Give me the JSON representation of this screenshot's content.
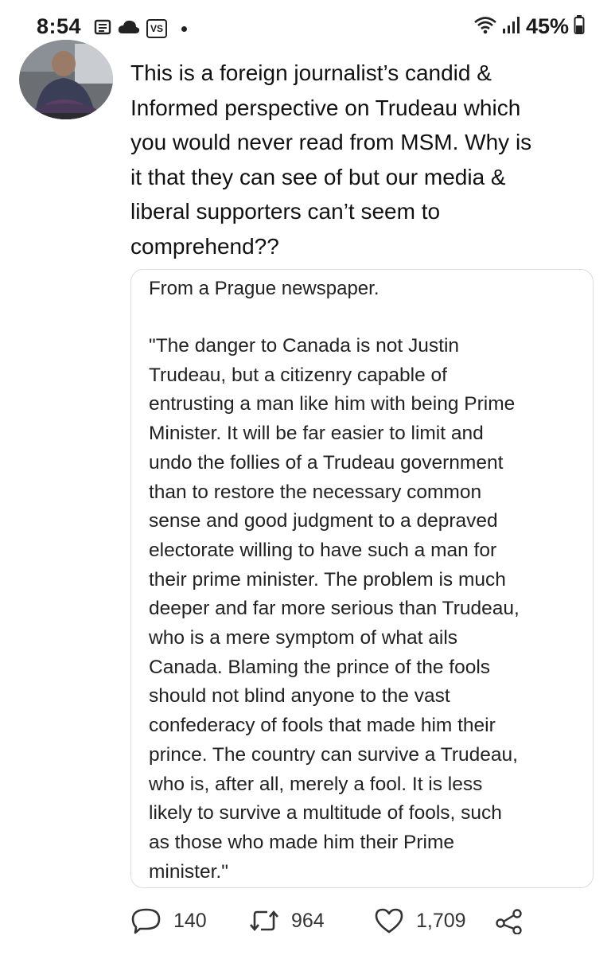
{
  "status_bar": {
    "time": "8:54",
    "vs_badge": "VS",
    "battery": "45%"
  },
  "tweet": {
    "text": "This is a foreign journalist’s candid &\nInformed perspective on Trudeau which\nyou would never read from MSM. Why is\nit that they can see of but our media &\nliberal supporters can’t seem to\ncomprehend??"
  },
  "quoted_image": {
    "source": "From a Prague newspaper.",
    "body": "\"The danger to Canada is not Justin\nTrudeau, but a citizenry capable of\nentrusting a man like him with being Prime\nMinister. It will be far easier to limit and\nundo the follies of a Trudeau government\nthan to restore the necessary common\nsense and good judgment to a depraved\nelectorate willing to have such a man for\ntheir prime minister. The problem is much\ndeeper and far more serious than Trudeau,\nwho is a mere symptom of what ails\nCanada. Blaming the prince of the fools\nshould not blind anyone to the vast\nconfederacy of fools that made him their\nprince. The country can survive a Trudeau,\nwho is, after all, merely a fool. It is less\nlikely to survive a multitude of fools, such\nas those who made him their Prime\nminister.\""
  },
  "actions": {
    "replies": "140",
    "retweets": "964",
    "likes": "1,709"
  },
  "icons": {
    "reply": "reply-icon",
    "retweet": "retweet-icon",
    "like": "heart-icon",
    "share": "share-icon"
  }
}
